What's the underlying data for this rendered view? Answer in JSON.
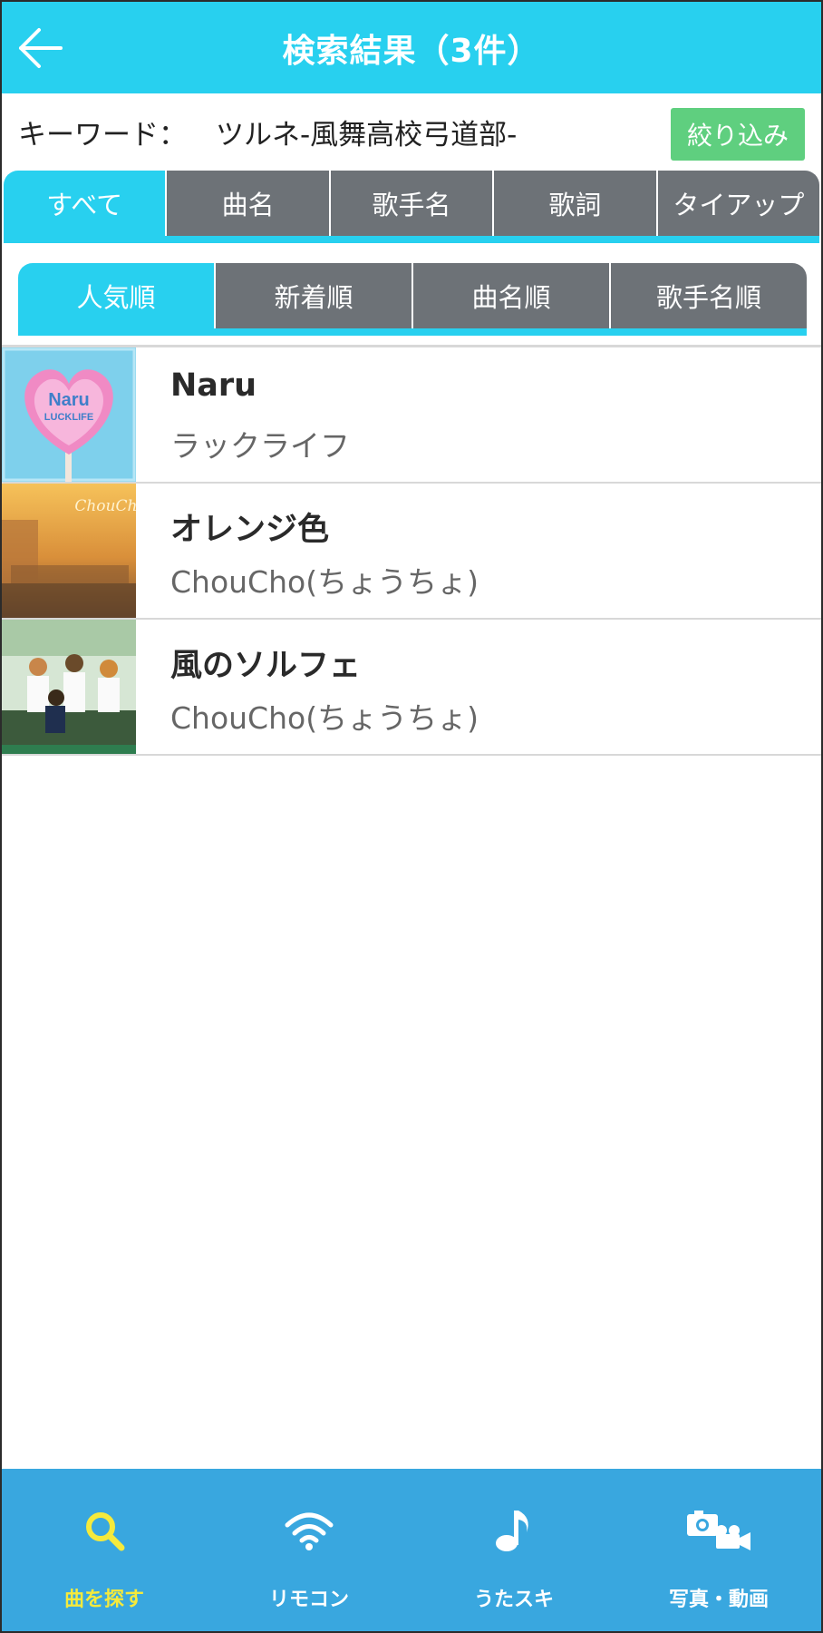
{
  "header": {
    "title": "検索結果（3件）"
  },
  "keyword": {
    "label": "キーワード：",
    "value": "ツルネ-風舞高校弓道部-",
    "filter_label": "絞り込み"
  },
  "category_tabs": [
    {
      "label": "すべて",
      "active": true
    },
    {
      "label": "曲名",
      "active": false
    },
    {
      "label": "歌手名",
      "active": false
    },
    {
      "label": "歌詞",
      "active": false
    },
    {
      "label": "タイアップ",
      "active": false
    }
  ],
  "sort_tabs": [
    {
      "label": "人気順",
      "active": true
    },
    {
      "label": "新着順",
      "active": false
    },
    {
      "label": "曲名順",
      "active": false
    },
    {
      "label": "歌手名順",
      "active": false
    }
  ],
  "results": [
    {
      "title": "Naru",
      "artist": "ラックライフ",
      "thumb_text_1": "Naru",
      "thumb_text_2": "LUCKLIFE"
    },
    {
      "title": "オレンジ色",
      "artist": "ChouCho(ちょうちょ)",
      "thumb_text_1": "ChouCho"
    },
    {
      "title": "風のソルフェ",
      "artist": "ChouCho(ちょうちょ)"
    }
  ],
  "bottom_nav": [
    {
      "label": "曲を探す",
      "icon": "search-icon",
      "active": true
    },
    {
      "label": "リモコン",
      "icon": "wifi-icon",
      "active": false
    },
    {
      "label": "うたスキ",
      "icon": "music-note-icon",
      "active": false
    },
    {
      "label": "写真・動画",
      "icon": "camera-video-icon",
      "active": false
    }
  ],
  "colors": {
    "accent": "#28d0ef",
    "tab_inactive": "#6d7277",
    "filter_green": "#5fcf7f",
    "nav_bg": "#39a7df",
    "nav_active": "#f5ea3c"
  }
}
